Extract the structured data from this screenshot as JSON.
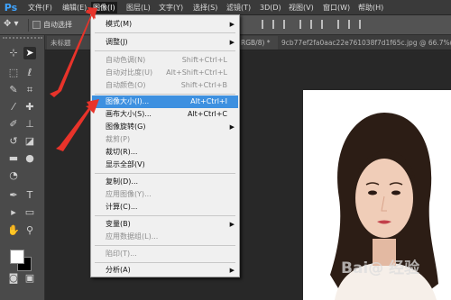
{
  "app": {
    "logo": "Ps"
  },
  "menubar": {
    "items": [
      "文件(F)",
      "编辑(E)",
      "图像(I)",
      "图层(L)",
      "文字(Y)",
      "选择(S)",
      "滤镜(T)",
      "3D(D)",
      "视图(V)",
      "窗口(W)",
      "帮助(H)"
    ],
    "active": "图像(I)"
  },
  "options_bar": {
    "auto_select_label": "自动选择",
    "auto_select_checked": false
  },
  "tabs": [
    {
      "label": "未标题"
    },
    {
      "label": "RGB/8) *"
    },
    {
      "label": "9cb77ef2fa0aac22e761038f7d1f65c.jpg @ 66.7%("
    }
  ],
  "image_menu": {
    "items": [
      {
        "label": "模式(M)",
        "shortcut": "",
        "submenu": true,
        "disabled": false,
        "highlighted": false
      },
      {
        "label": "调整(J)",
        "shortcut": "",
        "submenu": true,
        "disabled": false,
        "highlighted": false
      },
      {
        "label": "自动色调(N)",
        "shortcut": "Shift+Ctrl+L",
        "submenu": false,
        "disabled": true,
        "highlighted": false
      },
      {
        "label": "自动对比度(U)",
        "shortcut": "Alt+Shift+Ctrl+L",
        "submenu": false,
        "disabled": true,
        "highlighted": false
      },
      {
        "label": "自动颜色(O)",
        "shortcut": "Shift+Ctrl+B",
        "submenu": false,
        "disabled": true,
        "highlighted": false
      },
      {
        "label": "图像大小(I)...",
        "shortcut": "Alt+Ctrl+I",
        "submenu": false,
        "disabled": false,
        "highlighted": true
      },
      {
        "label": "画布大小(S)...",
        "shortcut": "Alt+Ctrl+C",
        "submenu": false,
        "disabled": false,
        "highlighted": false
      },
      {
        "label": "图像旋转(G)",
        "shortcut": "",
        "submenu": true,
        "disabled": false,
        "highlighted": false
      },
      {
        "label": "裁剪(P)",
        "shortcut": "",
        "submenu": false,
        "disabled": true,
        "highlighted": false
      },
      {
        "label": "裁切(R)...",
        "shortcut": "",
        "submenu": false,
        "disabled": false,
        "highlighted": false
      },
      {
        "label": "显示全部(V)",
        "shortcut": "",
        "submenu": false,
        "disabled": false,
        "highlighted": false
      },
      {
        "label": "复制(D)...",
        "shortcut": "",
        "submenu": false,
        "disabled": false,
        "highlighted": false
      },
      {
        "label": "应用图像(Y)...",
        "shortcut": "",
        "submenu": false,
        "disabled": true,
        "highlighted": false
      },
      {
        "label": "计算(C)...",
        "shortcut": "",
        "submenu": false,
        "disabled": false,
        "highlighted": false
      },
      {
        "label": "变量(B)",
        "shortcut": "",
        "submenu": true,
        "disabled": false,
        "highlighted": false
      },
      {
        "label": "应用数据组(L)...",
        "shortcut": "",
        "submenu": false,
        "disabled": true,
        "highlighted": false
      },
      {
        "label": "陷印(T)...",
        "shortcut": "",
        "submenu": false,
        "disabled": true,
        "highlighted": false
      },
      {
        "label": "分析(A)",
        "shortcut": "",
        "submenu": true,
        "disabled": false,
        "highlighted": false
      }
    ]
  },
  "icons": {
    "tools": [
      "move-tool-icon",
      "artboard-icon",
      "marquee-tool-icon",
      "lasso-tool-icon",
      "quick-select-icon",
      "crop-tool-icon",
      "eyedropper-icon",
      "healing-brush-icon",
      "brush-tool-icon",
      "clone-stamp-icon",
      "history-brush-icon",
      "eraser-icon",
      "gradient-icon",
      "blur-icon",
      "dodge-icon",
      "pen-tool-icon",
      "type-tool-icon",
      "path-select-icon",
      "rectangle-tool-icon",
      "hand-tool-icon",
      "zoom-tool-icon"
    ],
    "swatches": [
      "foreground-color-swatch",
      "background-color-swatch"
    ]
  },
  "colors": {
    "highlight": "#3d90e0",
    "annotation_arrow": "#e8332a",
    "foreground_color": "#ffffff",
    "background_color": "#000000"
  },
  "watermark": {
    "text": "Bai@ 经验"
  }
}
